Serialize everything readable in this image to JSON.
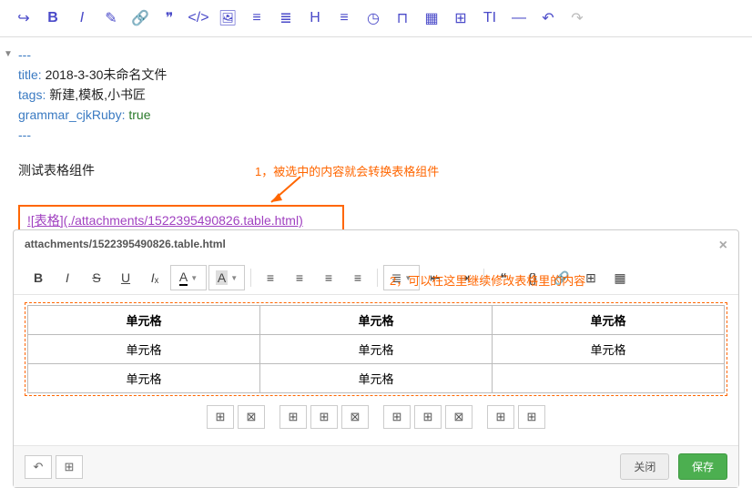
{
  "frontmatter": {
    "dashes": "---",
    "title_key": "title:",
    "title_val": "2018-3-30未命名文件",
    "tags_key": "tags:",
    "tags_val": "新建,模板,小书匠",
    "grammar_key": "grammar_cjkRuby:",
    "grammar_val": "true"
  },
  "content": {
    "test_line": "测试表格组件",
    "link_text": "![表格](./attachments/1522395490826.table.html)"
  },
  "annotations": {
    "a1": "1，被选中的内容就会转换表格组件",
    "a2": "2，可以在这里继续修改表格里的内容"
  },
  "modal": {
    "title": "attachments/1522395490826.table.html",
    "font_color_letter": "A",
    "bg_color_letter": "A",
    "close_label": "关闭",
    "save_label": "保存"
  },
  "chart_data": {
    "type": "table",
    "headers": [
      "单元格",
      "单元格",
      "单元格"
    ],
    "rows": [
      [
        "单元格",
        "单元格",
        "单元格"
      ],
      [
        "单元格",
        "单元格",
        ""
      ]
    ]
  }
}
